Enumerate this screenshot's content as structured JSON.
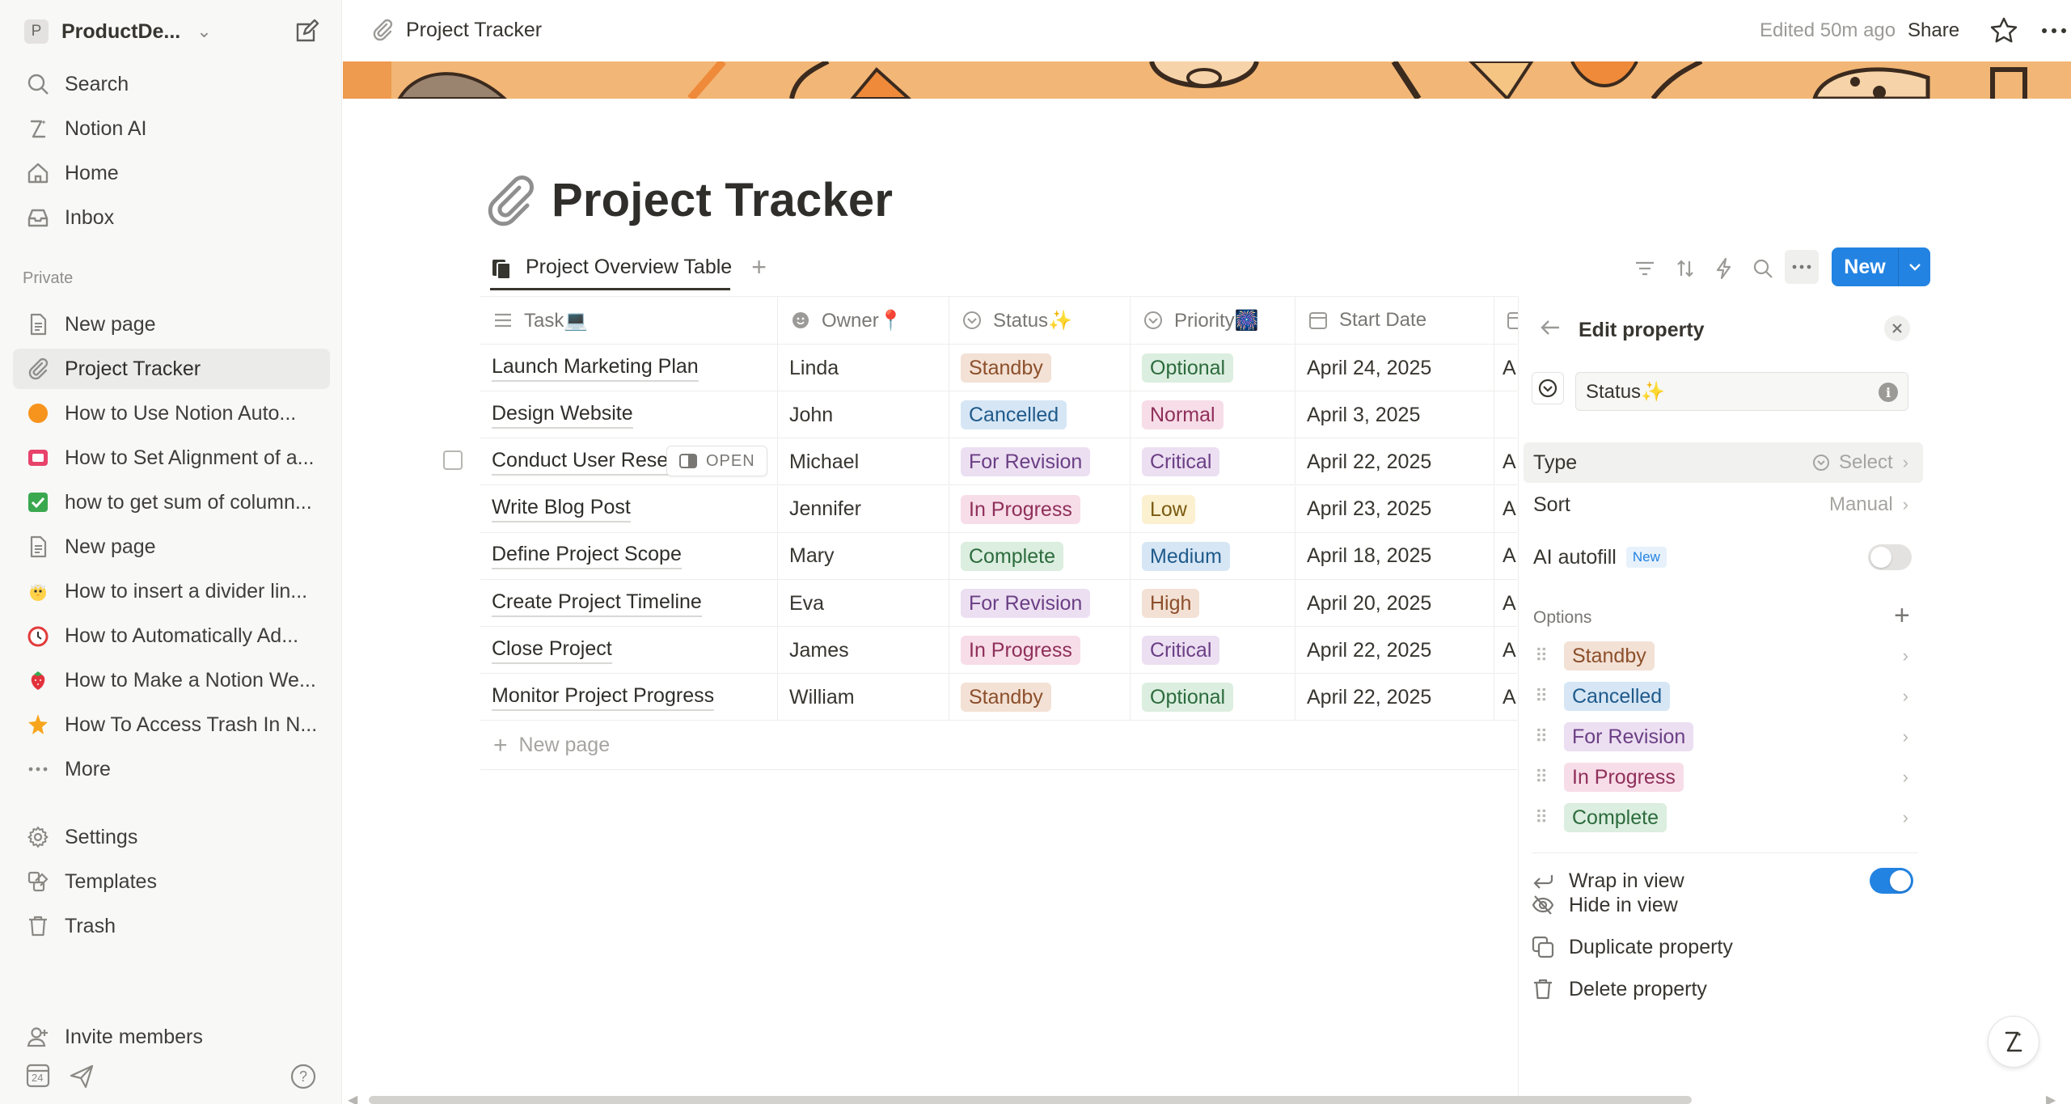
{
  "sidebar": {
    "workspace": {
      "initial": "P",
      "name": "ProductDe..."
    },
    "top_items": [
      {
        "label": "Search",
        "icon": "search-icon"
      },
      {
        "label": "Notion AI",
        "icon": "notion-ai-icon"
      },
      {
        "label": "Home",
        "icon": "home-icon"
      },
      {
        "label": "Inbox",
        "icon": "inbox-icon"
      }
    ],
    "section_label": "Private",
    "pages": [
      {
        "label": "New page",
        "icon": "page-icon"
      },
      {
        "label": "Project Tracker",
        "icon": "paperclip-icon",
        "active": true
      },
      {
        "label": "How to Use Notion Auto...",
        "icon": "orange-circle-icon"
      },
      {
        "label": "How to Set Alignment of a...",
        "icon": "tv-icon"
      },
      {
        "label": "how to get sum of column...",
        "icon": "check-mark-icon"
      },
      {
        "label": "New page",
        "icon": "page-icon"
      },
      {
        "label": "How to insert a divider lin...",
        "icon": "chick-icon"
      },
      {
        "label": "How to Automatically Ad...",
        "icon": "alarm-clock-icon"
      },
      {
        "label": "How to Make a Notion We...",
        "icon": "strawberry-icon"
      },
      {
        "label": "How To Access Trash In N...",
        "icon": "star-icon"
      },
      {
        "label": "More",
        "icon": "more-icon"
      }
    ],
    "bottom_items": [
      {
        "label": "Settings",
        "icon": "gear-icon"
      },
      {
        "label": "Templates",
        "icon": "templates-icon"
      },
      {
        "label": "Trash",
        "icon": "trash-icon"
      }
    ],
    "invite_label": "Invite members",
    "calendar_day": "24"
  },
  "topbar": {
    "breadcrumb": "Project Tracker",
    "edited": "Edited 50m ago",
    "share": "Share"
  },
  "page": {
    "title": "Project Tracker",
    "view_name": "Project Overview Table",
    "new_button": "New"
  },
  "table": {
    "columns": [
      {
        "label": "Task💻",
        "icon": "title-icon"
      },
      {
        "label": "Owner📍",
        "icon": "person-icon"
      },
      {
        "label": "Status✨",
        "icon": "select-icon"
      },
      {
        "label": "Priority🎆",
        "icon": "select-icon"
      },
      {
        "label": "Start Date",
        "icon": "calendar-icon"
      }
    ],
    "rows": [
      {
        "task": "Launch Marketing Plan",
        "owner": "Linda",
        "status": "Standby",
        "priority": "Optional",
        "start": "April 24, 2025",
        "end": "Ap"
      },
      {
        "task": "Design Website",
        "owner": "John",
        "status": "Cancelled",
        "priority": "Normal",
        "start": "April 3, 2025",
        "end": ""
      },
      {
        "task": "Conduct User Resea",
        "owner": "Michael",
        "status": "For Revision",
        "priority": "Critical",
        "start": "April 22, 2025",
        "end": "Ap"
      },
      {
        "task": "Write Blog Post",
        "owner": "Jennifer",
        "status": "In Progress",
        "priority": "Low",
        "start": "April 23, 2025",
        "end": "Ap"
      },
      {
        "task": "Define Project Scope",
        "owner": "Mary",
        "status": "Complete",
        "priority": "Medium",
        "start": "April 18, 2025",
        "end": "Ap"
      },
      {
        "task": "Create Project Timeline",
        "owner": "Eva",
        "status": "For Revision",
        "priority": "High",
        "start": "April 20, 2025",
        "end": "Ap"
      },
      {
        "task": "Close Project",
        "owner": "James",
        "status": "In Progress",
        "priority": "Critical",
        "start": "April 22, 2025",
        "end": "Ap"
      },
      {
        "task": "Monitor Project Progress",
        "owner": "William",
        "status": "Standby",
        "priority": "Optional",
        "start": "April 22, 2025",
        "end": "Ap"
      }
    ],
    "open_label": "OPEN",
    "new_page": "New page"
  },
  "colors": {
    "Standby": [
      "#f3e1d5",
      "#8c4f2b"
    ],
    "Cancelled": [
      "#d6e6f5",
      "#1f5a8a"
    ],
    "For Revision": [
      "#ecdff2",
      "#6b3f85"
    ],
    "In Progress": [
      "#f7dde8",
      "#8f2f5a"
    ],
    "Complete": [
      "#dbeedf",
      "#2c6b3d"
    ],
    "Optional": [
      "#dbeedf",
      "#2c6b3d"
    ],
    "Normal": [
      "#f7dde8",
      "#8f2f5a"
    ],
    "Critical": [
      "#ecdff2",
      "#6b3f85"
    ],
    "Low": [
      "#fbf0cf",
      "#7a5a10"
    ],
    "Medium": [
      "#d6e6f5",
      "#1f5a8a"
    ],
    "High": [
      "#f3e1d5",
      "#8c4f2b"
    ],
    "accent": "#2383e2"
  },
  "panel": {
    "title": "Edit property",
    "property_name": "Status✨",
    "type_label": "Type",
    "type_value": "Select",
    "sort_label": "Sort",
    "sort_value": "Manual",
    "ai_autofill": "AI autofill",
    "new_badge": "New",
    "options_label": "Options",
    "options": [
      "Standby",
      "Cancelled",
      "For Revision",
      "In Progress",
      "Complete"
    ],
    "wrap": "Wrap in view",
    "wrap_on": true,
    "ai_autofill_on": false,
    "hide": "Hide in view",
    "duplicate": "Duplicate property",
    "delete": "Delete property"
  }
}
